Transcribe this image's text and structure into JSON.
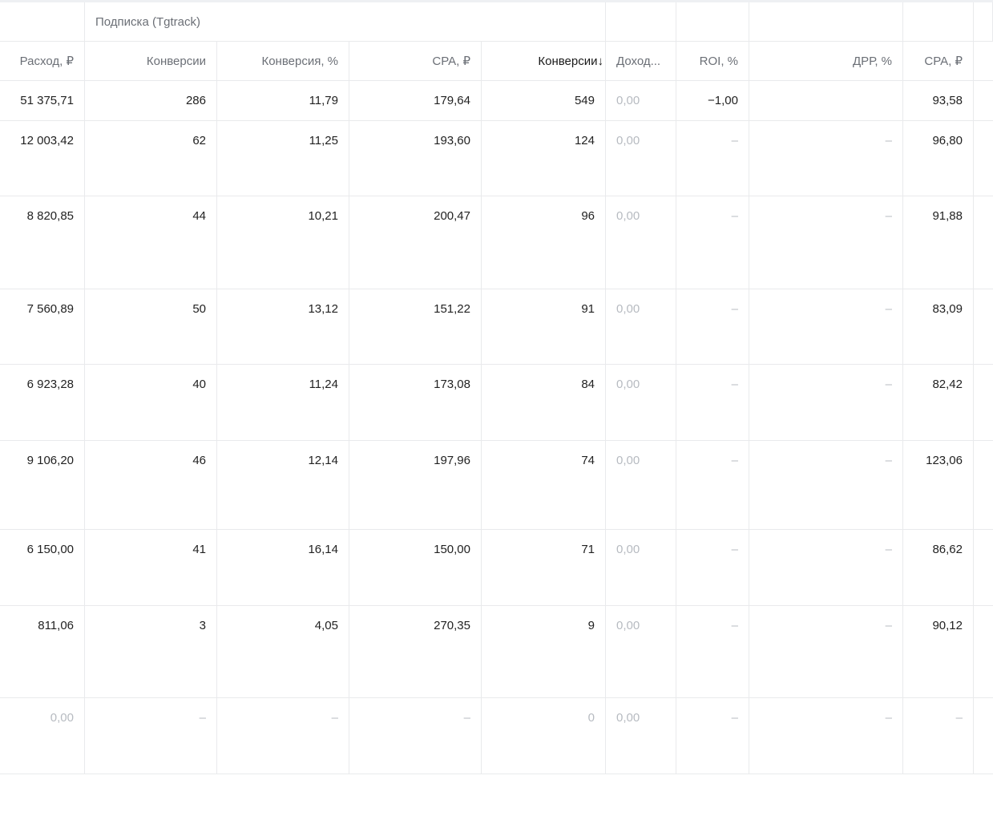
{
  "table": {
    "group_header": "Подписка (Tgtrack)",
    "columns": [
      {
        "key": "spend",
        "label": "Расход, ₽"
      },
      {
        "key": "conv",
        "label": "Конверсии"
      },
      {
        "key": "conv_rate",
        "label": "Конверсия, %"
      },
      {
        "key": "cpa",
        "label": "CPA, ₽"
      },
      {
        "key": "conv_total",
        "label": "Конверсии",
        "sort_indicator": "↓",
        "active": true
      },
      {
        "key": "revenue",
        "label": "Доход..."
      },
      {
        "key": "roi",
        "label": "ROI, %"
      },
      {
        "key": "drr",
        "label": "ДРР, %"
      },
      {
        "key": "cpa2",
        "label": "CPA, ₽"
      }
    ],
    "rows": [
      {
        "spend": "51 375,71",
        "conv": "286",
        "conv_rate": "11,79",
        "cpa": "179,64",
        "conv_total": "549",
        "revenue": "0,00",
        "roi": "−1,00",
        "drr": "",
        "cpa2": "93,58"
      },
      {
        "spend": "12 003,42",
        "conv": "62",
        "conv_rate": "11,25",
        "cpa": "193,60",
        "conv_total": "124",
        "revenue": "0,00",
        "roi": "–",
        "drr": "–",
        "cpa2": "96,80"
      },
      {
        "spend": "8 820,85",
        "conv": "44",
        "conv_rate": "10,21",
        "cpa": "200,47",
        "conv_total": "96",
        "revenue": "0,00",
        "roi": "–",
        "drr": "–",
        "cpa2": "91,88"
      },
      {
        "spend": "7 560,89",
        "conv": "50",
        "conv_rate": "13,12",
        "cpa": "151,22",
        "conv_total": "91",
        "revenue": "0,00",
        "roi": "–",
        "drr": "–",
        "cpa2": "83,09"
      },
      {
        "spend": "6 923,28",
        "conv": "40",
        "conv_rate": "11,24",
        "cpa": "173,08",
        "conv_total": "84",
        "revenue": "0,00",
        "roi": "–",
        "drr": "–",
        "cpa2": "82,42"
      },
      {
        "spend": "9 106,20",
        "conv": "46",
        "conv_rate": "12,14",
        "cpa": "197,96",
        "conv_total": "74",
        "revenue": "0,00",
        "roi": "–",
        "drr": "–",
        "cpa2": "123,06"
      },
      {
        "spend": "6 150,00",
        "conv": "41",
        "conv_rate": "16,14",
        "cpa": "150,00",
        "conv_total": "71",
        "revenue": "0,00",
        "roi": "–",
        "drr": "–",
        "cpa2": "86,62"
      },
      {
        "spend": "811,06",
        "conv": "3",
        "conv_rate": "4,05",
        "cpa": "270,35",
        "conv_total": "9",
        "revenue": "0,00",
        "roi": "–",
        "drr": "–",
        "cpa2": "90,12"
      },
      {
        "spend": "0,00",
        "conv": "–",
        "conv_rate": "–",
        "cpa": "–",
        "conv_total": "0",
        "revenue": "0,00",
        "roi": "–",
        "drr": "–",
        "cpa2": "–"
      }
    ]
  },
  "colors": {
    "text": "#222222",
    "header_text": "#6b6f76",
    "muted_text": "#b7bbc1",
    "border": "#e9eaec"
  }
}
